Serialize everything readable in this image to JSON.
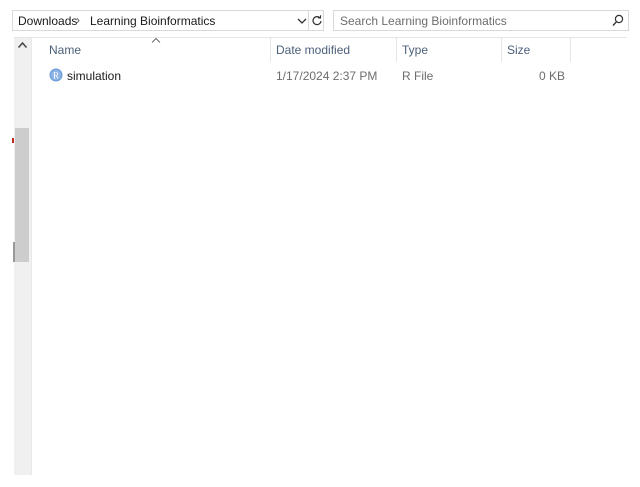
{
  "breadcrumb": {
    "items": [
      "Downloads",
      "Learning Bioinformatics"
    ],
    "separator": "›"
  },
  "search": {
    "placeholder": "Search Learning Bioinformatics"
  },
  "columns": {
    "name": "Name",
    "date_modified": "Date modified",
    "type": "Type",
    "size": "Size"
  },
  "files": [
    {
      "name": "simulation",
      "date_modified": "1/17/2024 2:37 PM",
      "type": "R File",
      "size": "0 KB",
      "icon": "r-file-icon",
      "icon_letter": "R"
    }
  ],
  "colors": {
    "header_text": "#4c607a",
    "r_icon": "#6f9fd8",
    "scroll_thumb": "#cdcdcd"
  }
}
